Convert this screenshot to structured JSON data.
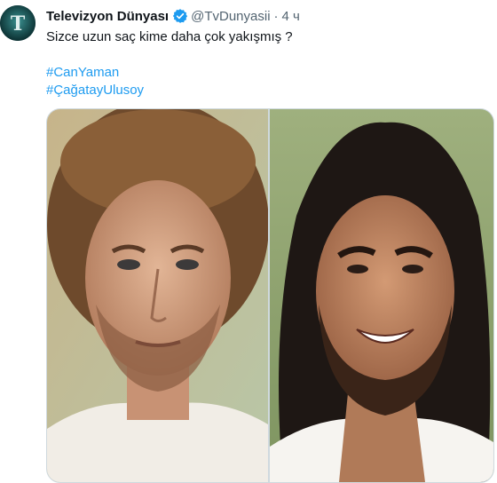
{
  "tweet": {
    "author_name": "Televizyon Dünyası",
    "avatar_letter": "T",
    "handle": "@TvDunyasii",
    "separator": "·",
    "time": "4 ч",
    "text": "Sizce uzun saç kime daha çok yakışmış ?",
    "hashtags": [
      "#CanYaman",
      "#ÇağatayUlusoy"
    ]
  },
  "colors": {
    "accent": "#1d9bf0",
    "text_primary": "#0f1419",
    "text_secondary": "#536471",
    "border": "#cfd9de"
  },
  "icons": {
    "verified": "verified-badge-icon"
  }
}
